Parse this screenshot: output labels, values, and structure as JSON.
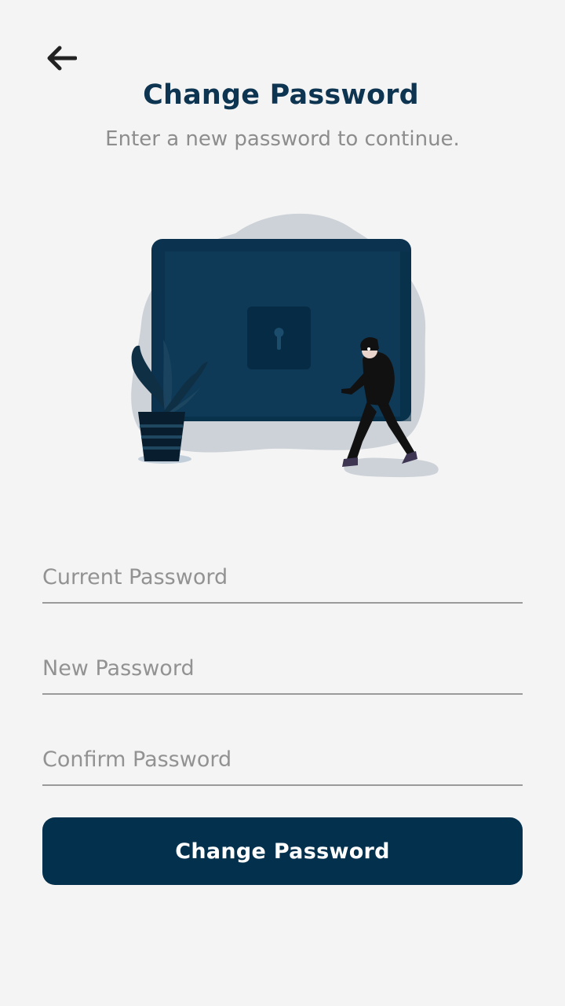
{
  "header": {
    "back_icon": "arrow-left-icon",
    "title": "Change Password",
    "subtitle": "Enter a new password to continue."
  },
  "illustration": {
    "description_icon": "locked-screen-thief-illustration",
    "colors": {
      "screen": "#0d3450",
      "blob": "#cdd2d8",
      "thief": "#111111"
    }
  },
  "form": {
    "current_password_placeholder": "Current Password",
    "new_password_placeholder": "New Password",
    "confirm_password_placeholder": "Confirm Password",
    "submit_label": "Change Password"
  },
  "colors": {
    "background": "#f4f4f4",
    "primary": "#03314d",
    "title": "#0d3450",
    "muted_text": "#8d8d8d"
  }
}
